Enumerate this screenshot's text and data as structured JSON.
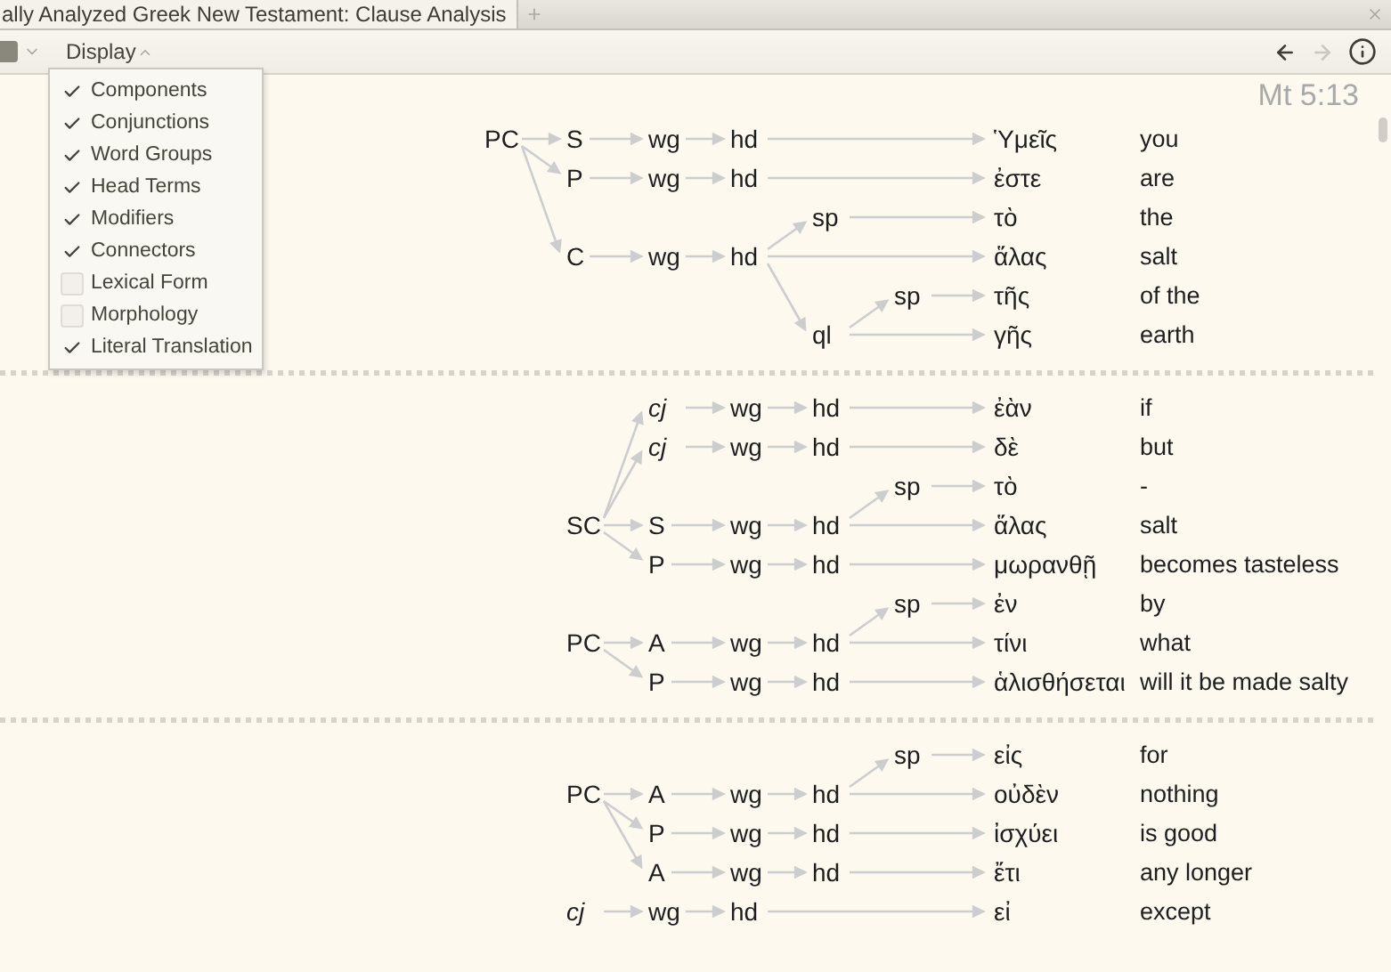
{
  "tab": {
    "title": "ally Analyzed Greek New Testament: Clause Analysis"
  },
  "toolbar": {
    "display_menu": {
      "label": "Display",
      "open": true,
      "items": [
        {
          "label": "Components",
          "checked": true
        },
        {
          "label": "Conjunctions",
          "checked": true
        },
        {
          "label": "Word Groups",
          "checked": true
        },
        {
          "label": "Head Terms",
          "checked": true
        },
        {
          "label": "Modifiers",
          "checked": true
        },
        {
          "label": "Connectors",
          "checked": true
        },
        {
          "label": "Lexical Form",
          "checked": false
        },
        {
          "label": "Morphology",
          "checked": false
        },
        {
          "label": "Literal Translation",
          "checked": true
        }
      ]
    },
    "back": {
      "disabled": false
    },
    "forward": {
      "disabled": true
    }
  },
  "reference": "Mt 5:13",
  "sections": [
    {
      "trees": [
        {
          "label": "PC",
          "kind": "component",
          "children": [
            {
              "label": "S",
              "kind": "component",
              "children": [
                {
                  "label": "wg",
                  "kind": "component",
                  "children": [
                    {
                      "label": "hd",
                      "kind": "component",
                      "children": [
                        {
                          "kind": "word",
                          "greek": "Ὑμεῖς",
                          "translation": "you"
                        }
                      ]
                    }
                  ]
                }
              ]
            },
            {
              "label": "P",
              "kind": "component",
              "children": [
                {
                  "label": "wg",
                  "kind": "component",
                  "children": [
                    {
                      "label": "hd",
                      "kind": "component",
                      "children": [
                        {
                          "kind": "word",
                          "greek": "ἐστε",
                          "translation": "are"
                        }
                      ]
                    }
                  ]
                }
              ]
            },
            {
              "label": "C",
              "kind": "component",
              "children": [
                {
                  "label": "wg",
                  "kind": "component",
                  "children": [
                    {
                      "label": "hd",
                      "kind": "component",
                      "children": [
                        {
                          "label": "sp",
                          "kind": "component",
                          "children": [
                            {
                              "kind": "word",
                              "greek": "τὸ",
                              "translation": "the"
                            }
                          ]
                        },
                        {
                          "kind": "word",
                          "greek": "ἅλας",
                          "translation": "salt"
                        },
                        {
                          "label": "ql",
                          "kind": "component",
                          "children": [
                            {
                              "label": "sp",
                              "kind": "component",
                              "children": [
                                {
                                  "kind": "word",
                                  "greek": "τῆς",
                                  "translation": "of the"
                                }
                              ]
                            },
                            {
                              "kind": "word",
                              "greek": "γῆς",
                              "translation": "earth"
                            }
                          ]
                        }
                      ]
                    }
                  ]
                }
              ]
            }
          ]
        }
      ]
    },
    {
      "trees": [
        {
          "label": "SC",
          "kind": "component",
          "children": [
            {
              "label": "cj",
              "kind": "conjunction",
              "children": [
                {
                  "label": "wg",
                  "kind": "component",
                  "children": [
                    {
                      "label": "hd",
                      "kind": "component",
                      "children": [
                        {
                          "kind": "word",
                          "greek": "ἐὰν",
                          "translation": "if"
                        }
                      ]
                    }
                  ]
                }
              ]
            },
            {
              "label": "cj",
              "kind": "conjunction",
              "children": [
                {
                  "label": "wg",
                  "kind": "component",
                  "children": [
                    {
                      "label": "hd",
                      "kind": "component",
                      "children": [
                        {
                          "kind": "word",
                          "greek": "δὲ",
                          "translation": "but"
                        }
                      ]
                    }
                  ]
                }
              ]
            },
            {
              "label": "S",
              "kind": "component",
              "children": [
                {
                  "label": "wg",
                  "kind": "component",
                  "children": [
                    {
                      "label": "hd",
                      "kind": "component",
                      "children": [
                        {
                          "label": "sp",
                          "kind": "component",
                          "children": [
                            {
                              "kind": "word",
                              "greek": "τὸ",
                              "translation": "-"
                            }
                          ]
                        },
                        {
                          "kind": "word",
                          "greek": "ἅλας",
                          "translation": "salt"
                        }
                      ]
                    }
                  ]
                }
              ]
            },
            {
              "label": "P",
              "kind": "component",
              "children": [
                {
                  "label": "wg",
                  "kind": "component",
                  "children": [
                    {
                      "label": "hd",
                      "kind": "component",
                      "children": [
                        {
                          "kind": "word",
                          "greek": "μωρανθῇ",
                          "translation": "becomes tasteless"
                        }
                      ]
                    }
                  ]
                }
              ]
            }
          ]
        },
        {
          "label": "PC",
          "kind": "component",
          "children": [
            {
              "label": "A",
              "kind": "component",
              "children": [
                {
                  "label": "wg",
                  "kind": "component",
                  "children": [
                    {
                      "label": "hd",
                      "kind": "component",
                      "children": [
                        {
                          "label": "sp",
                          "kind": "component",
                          "children": [
                            {
                              "kind": "word",
                              "greek": "ἐν",
                              "translation": "by"
                            }
                          ]
                        },
                        {
                          "kind": "word",
                          "greek": "τίνι",
                          "translation": "what"
                        }
                      ]
                    }
                  ]
                }
              ]
            },
            {
              "label": "P",
              "kind": "component",
              "children": [
                {
                  "label": "wg",
                  "kind": "component",
                  "children": [
                    {
                      "label": "hd",
                      "kind": "component",
                      "children": [
                        {
                          "kind": "word",
                          "greek": "ἁλισθήσεται",
                          "translation": "will it be made salty"
                        }
                      ]
                    }
                  ]
                }
              ]
            }
          ]
        }
      ]
    },
    {
      "trees": [
        {
          "label": "PC",
          "kind": "component",
          "children": [
            {
              "label": "A",
              "kind": "component",
              "children": [
                {
                  "label": "wg",
                  "kind": "component",
                  "children": [
                    {
                      "label": "hd",
                      "kind": "component",
                      "children": [
                        {
                          "label": "sp",
                          "kind": "component",
                          "children": [
                            {
                              "kind": "word",
                              "greek": "εἰς",
                              "translation": "for"
                            }
                          ]
                        },
                        {
                          "kind": "word",
                          "greek": "οὐδὲν",
                          "translation": "nothing"
                        }
                      ]
                    }
                  ]
                }
              ]
            },
            {
              "label": "P",
              "kind": "component",
              "children": [
                {
                  "label": "wg",
                  "kind": "component",
                  "children": [
                    {
                      "label": "hd",
                      "kind": "component",
                      "children": [
                        {
                          "kind": "word",
                          "greek": "ἰσχύει",
                          "translation": "is good"
                        }
                      ]
                    }
                  ]
                }
              ]
            },
            {
              "label": "A",
              "kind": "component",
              "children": [
                {
                  "label": "wg",
                  "kind": "component",
                  "children": [
                    {
                      "label": "hd",
                      "kind": "component",
                      "children": [
                        {
                          "kind": "word",
                          "greek": "ἔτι",
                          "translation": "any longer"
                        }
                      ]
                    }
                  ]
                }
              ]
            }
          ]
        },
        {
          "label": "cj",
          "kind": "conjunction",
          "children": [
            {
              "label": "wg",
              "kind": "component",
              "children": [
                {
                  "label": "hd",
                  "kind": "component",
                  "children": [
                    {
                      "kind": "word",
                      "greek": "εἰ",
                      "translation": "except"
                    }
                  ]
                }
              ]
            }
          ]
        }
      ]
    }
  ]
}
